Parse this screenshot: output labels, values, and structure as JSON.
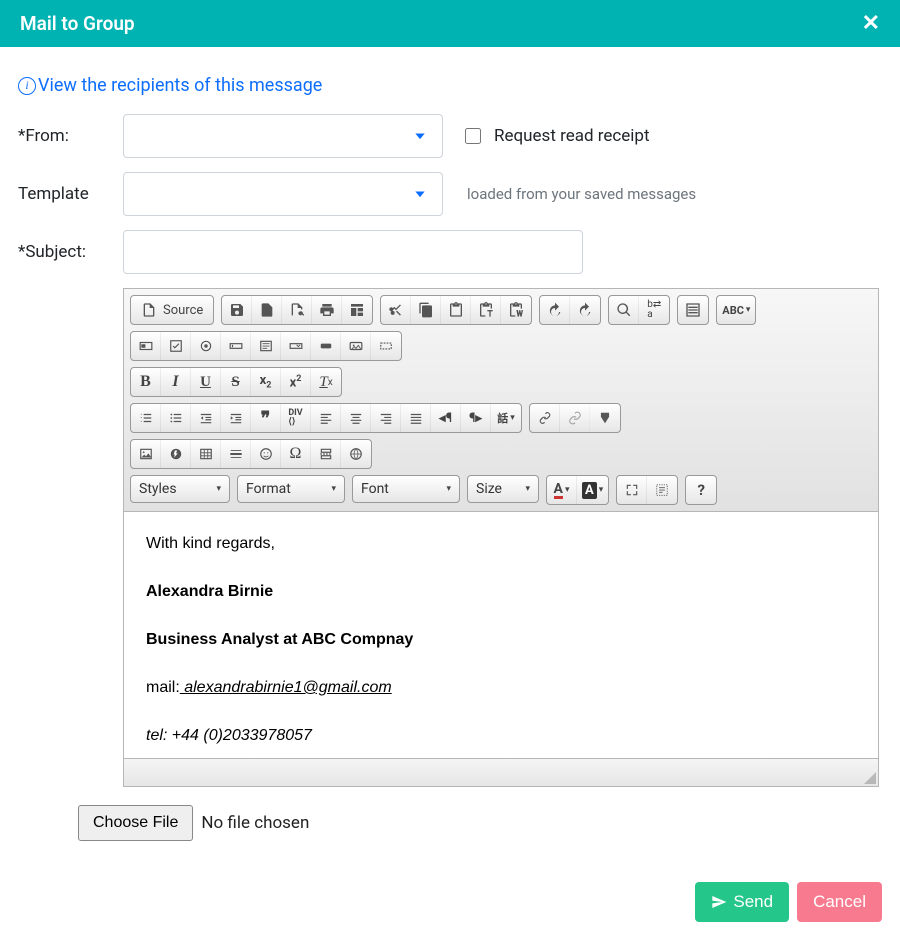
{
  "header": {
    "title": "Mail to Group"
  },
  "recipients_link": "View the recipients of this message",
  "labels": {
    "from": "*From:",
    "template": "Template",
    "subject": "*Subject:"
  },
  "read_receipt_label": "Request read receipt",
  "template_hint": "loaded from your saved messages",
  "editor": {
    "source_label": "Source",
    "dropdowns": {
      "styles": "Styles",
      "format": "Format",
      "font": "Font",
      "size": "Size"
    },
    "body": {
      "closing": "With kind regards,",
      "name": "Alexandra Birnie",
      "title": "Business Analyst at ABC Compnay",
      "mail_prefix": "mail:",
      "mail_link": " alexandrabirnie1@gmail.com",
      "tel": "tel: +44 (0)2033978057"
    }
  },
  "file": {
    "choose_label": "Choose File",
    "none_label": "No file chosen"
  },
  "buttons": {
    "send": "Send",
    "cancel": "Cancel"
  }
}
